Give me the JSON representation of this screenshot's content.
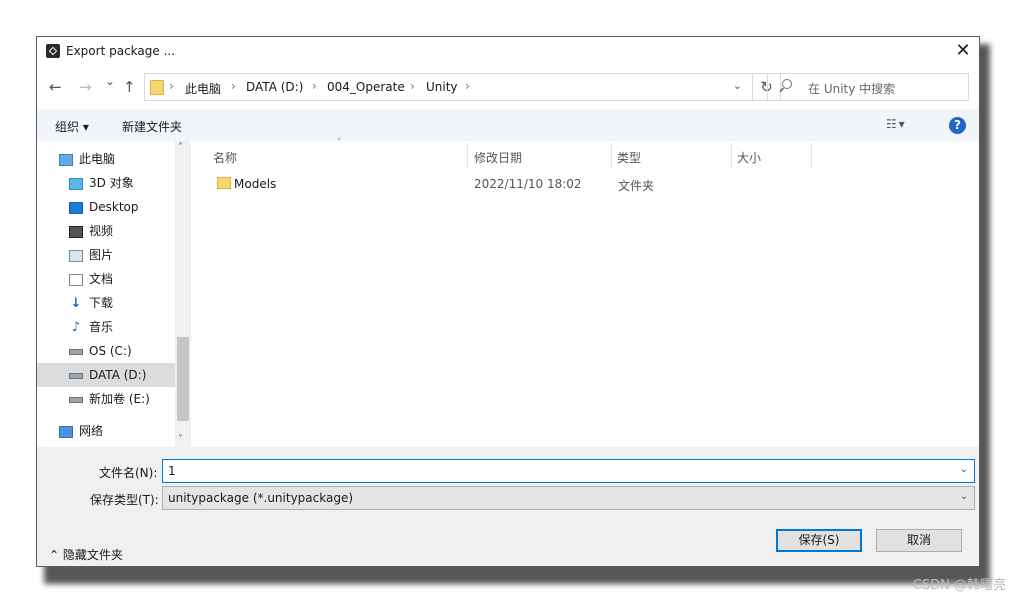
{
  "window": {
    "title": "Export package ...",
    "close": "✕"
  },
  "nav": {
    "back": "←",
    "forward": "→",
    "recent": "⌄",
    "up": "↑"
  },
  "breadcrumbs": [
    "此电脑",
    "DATA (D:)",
    "004_Operate",
    "Unity"
  ],
  "address": {
    "dropdown": "⌄",
    "refresh": "↻"
  },
  "search": {
    "placeholder": "在 Unity 中搜索"
  },
  "toolbar": {
    "organize": "组织 ▾",
    "new_folder": "新建文件夹",
    "view": "☷ ▾",
    "help": "?"
  },
  "sidebar": {
    "items": [
      {
        "label": "此电脑",
        "icon": "pc-icon"
      },
      {
        "label": "3D 对象",
        "icon": "cube-icon"
      },
      {
        "label": "Desktop",
        "icon": "desktop-icon"
      },
      {
        "label": "视频",
        "icon": "video-icon"
      },
      {
        "label": "图片",
        "icon": "pictures-icon"
      },
      {
        "label": "文档",
        "icon": "document-icon"
      },
      {
        "label": "下载",
        "icon": "download-icon"
      },
      {
        "label": "音乐",
        "icon": "music-icon"
      },
      {
        "label": "OS (C:)",
        "icon": "windows-drive-icon"
      },
      {
        "label": "DATA (D:)",
        "icon": "drive-icon",
        "selected": true
      },
      {
        "label": "新加卷 (E:)",
        "icon": "drive-icon"
      },
      {
        "label": "网络",
        "icon": "network-icon"
      }
    ],
    "scroll_up": "˄",
    "scroll_down": "˅"
  },
  "columns": {
    "name": "名称",
    "modified": "修改日期",
    "type": "类型",
    "size": "大小",
    "sort_indicator": "˄"
  },
  "files": [
    {
      "name": "Models",
      "modified": "2022/11/10 18:02",
      "type": "文件夹",
      "size": ""
    }
  ],
  "form": {
    "filename_label": "文件名(N):",
    "filename_value": "1",
    "filetype_label": "保存类型(T):",
    "filetype_value": "unitypackage (*.unitypackage)",
    "chevron": "⌄"
  },
  "footer": {
    "hide_folders": "⌃ 隐藏文件夹",
    "save": "保存(S)",
    "cancel": "取消"
  },
  "watermark": "CSDN @韩曙亮",
  "colors": {
    "accent": "#0078d7",
    "selection": "#dcdcdc",
    "command_bar": "#f1f4f8",
    "folder": "#f5d76e"
  }
}
